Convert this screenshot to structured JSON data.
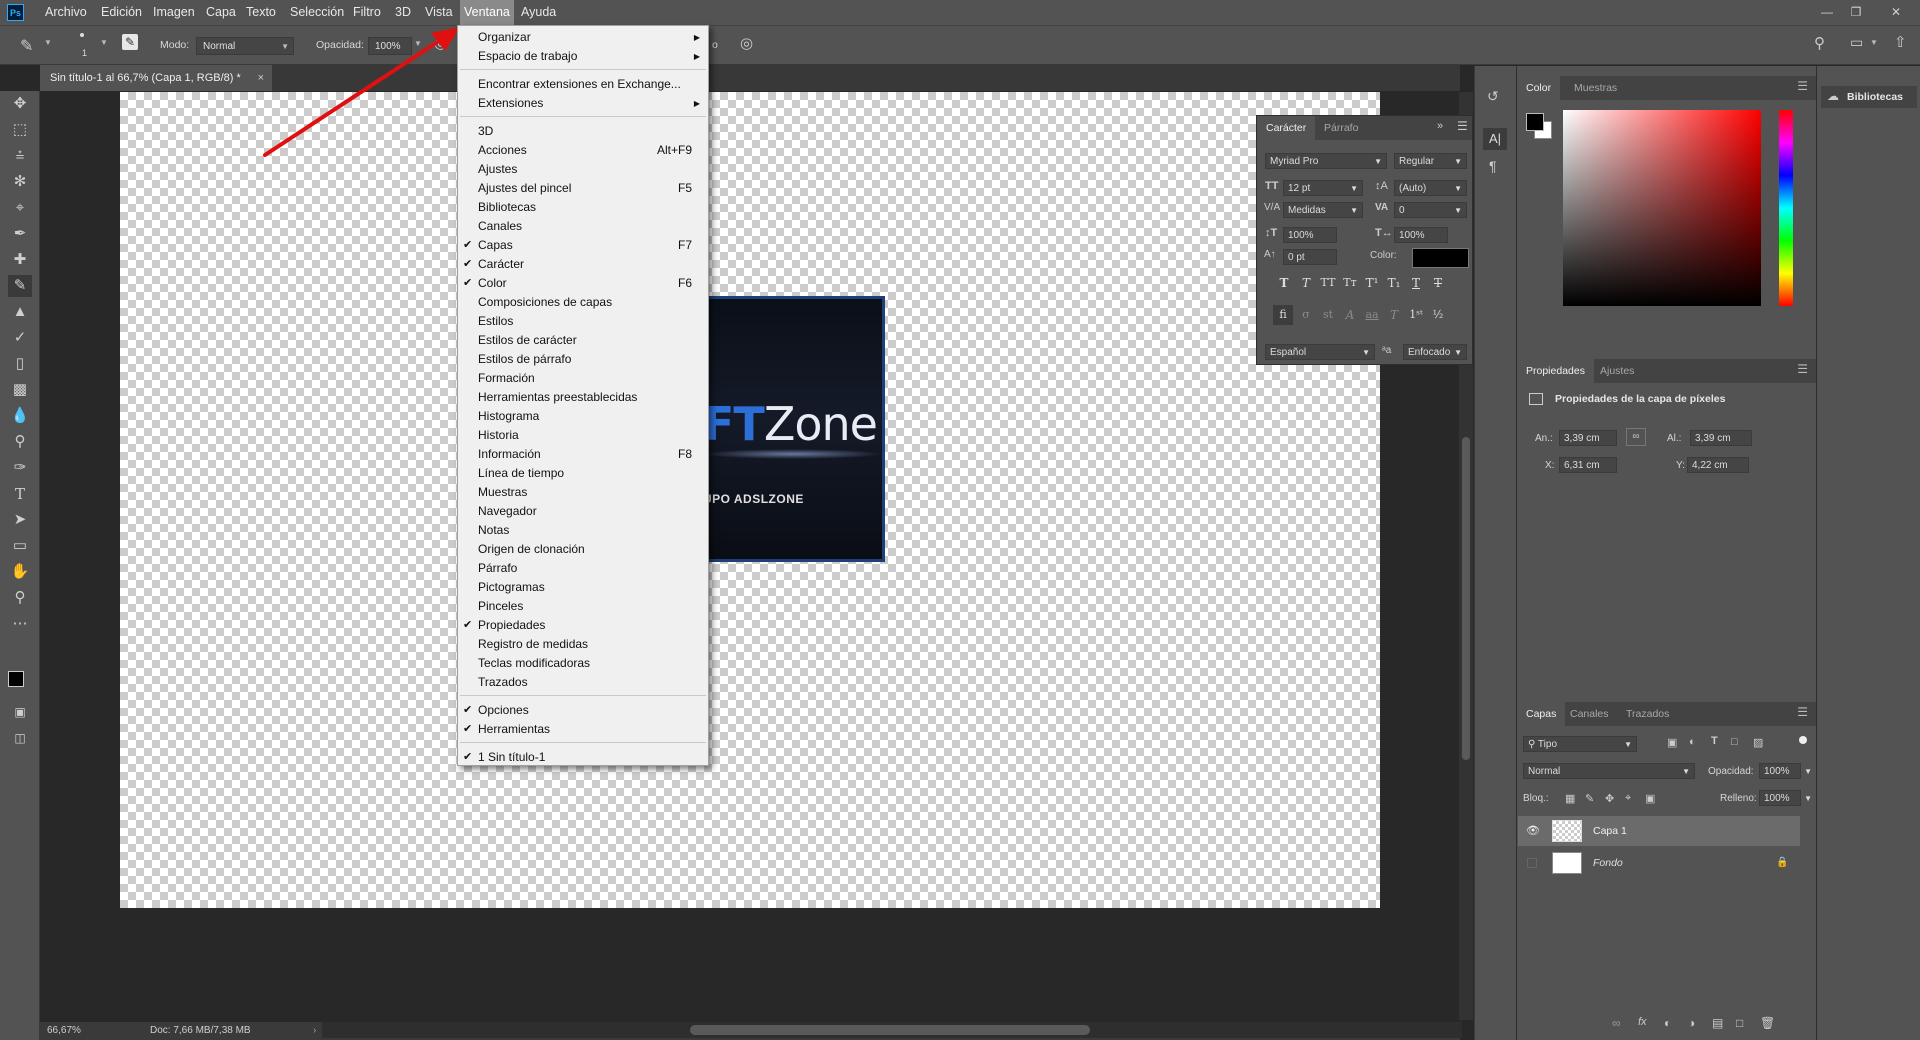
{
  "app": {
    "logo": "Ps",
    "accent": "#31a8ff"
  },
  "menubar": {
    "items": [
      "Archivo",
      "Edición",
      "Imagen",
      "Capa",
      "Texto",
      "Selección",
      "Filtro",
      "3D",
      "Vista",
      "Ventana",
      "Ayuda"
    ],
    "active": "Ventana"
  },
  "options": {
    "brush_size": "1",
    "mode_label": "Modo:",
    "mode_value": "Normal",
    "opacity_label": "Opacidad:",
    "opacity_value": "100%",
    "partial_text": "o"
  },
  "document": {
    "tab_title": "Sin título-1 al 66,7% (Capa 1, RGB/8) *",
    "image_text_highlight": "FT",
    "image_text_main": "Zone",
    "image_subtitle": "UPO ADSLZONE"
  },
  "status": {
    "zoom": "66,67%",
    "doc": "Doc: 7,66 MB/7,38 MB"
  },
  "ventana_menu": {
    "items": [
      {
        "label": "Organizar",
        "submenu": true
      },
      {
        "label": "Espacio de trabajo",
        "submenu": true
      },
      {
        "label": "Encontrar extensiones en Exchange..."
      },
      {
        "label": "Extensiones",
        "submenu": true
      },
      {
        "label": "3D"
      },
      {
        "label": "Acciones",
        "shortcut": "Alt+F9"
      },
      {
        "label": "Ajustes"
      },
      {
        "label": "Ajustes del pincel",
        "shortcut": "F5"
      },
      {
        "label": "Bibliotecas"
      },
      {
        "label": "Canales"
      },
      {
        "label": "Capas",
        "shortcut": "F7",
        "checked": true
      },
      {
        "label": "Carácter",
        "checked": true
      },
      {
        "label": "Color",
        "shortcut": "F6",
        "checked": true
      },
      {
        "label": "Composiciones de capas"
      },
      {
        "label": "Estilos"
      },
      {
        "label": "Estilos de carácter"
      },
      {
        "label": "Estilos de párrafo"
      },
      {
        "label": "Formación"
      },
      {
        "label": "Herramientas preestablecidas"
      },
      {
        "label": "Histograma"
      },
      {
        "label": "Historia"
      },
      {
        "label": "Información",
        "shortcut": "F8"
      },
      {
        "label": "Línea de tiempo"
      },
      {
        "label": "Muestras"
      },
      {
        "label": "Navegador"
      },
      {
        "label": "Notas"
      },
      {
        "label": "Origen de clonación"
      },
      {
        "label": "Párrafo"
      },
      {
        "label": "Pictogramas"
      },
      {
        "label": "Pinceles"
      },
      {
        "label": "Propiedades",
        "checked": true
      },
      {
        "label": "Registro de medidas"
      },
      {
        "label": "Teclas modificadoras"
      },
      {
        "label": "Trazados"
      },
      {
        "label": "Opciones",
        "checked": true
      },
      {
        "label": "Herramientas",
        "checked": true
      },
      {
        "label": "1 Sin título-1",
        "checked": true
      }
    ]
  },
  "character_panel": {
    "tabs": [
      "Carácter",
      "Párrafo"
    ],
    "font": "Myriad Pro",
    "style": "Regular",
    "size": "12 pt",
    "leading": "(Auto)",
    "kerning": "Medidas",
    "tracking": "0",
    "vscale": "100%",
    "hscale": "100%",
    "baseline": "0 pt",
    "color_label": "Color:",
    "language": "Español",
    "antialias": "Enfocado",
    "aa_glyph": "aa"
  },
  "color_panel": {
    "tabs": [
      "Color",
      "Muestras"
    ]
  },
  "properties_panel": {
    "tabs": [
      "Propiedades",
      "Ajustes"
    ],
    "heading": "Propiedades de la capa de píxeles",
    "w_label": "An.:",
    "w_value": "3,39 cm",
    "h_label": "Al.:",
    "h_value": "3,39 cm",
    "x_label": "X:",
    "x_value": "6,31 cm",
    "y_label": "Y:",
    "y_value": "4,22 cm"
  },
  "layers_panel": {
    "tabs": [
      "Capas",
      "Canales",
      "Trazados"
    ],
    "filter": "Tipo",
    "blend": "Normal",
    "opacity_label": "Opacidad:",
    "opacity_value": "100%",
    "lock_label": "Bloq.:",
    "fill_label": "Relleno:",
    "fill_value": "100%",
    "layers": [
      {
        "name": "Capa 1"
      },
      {
        "name": "Fondo"
      }
    ]
  },
  "libraries": {
    "label": "Bibliotecas"
  }
}
